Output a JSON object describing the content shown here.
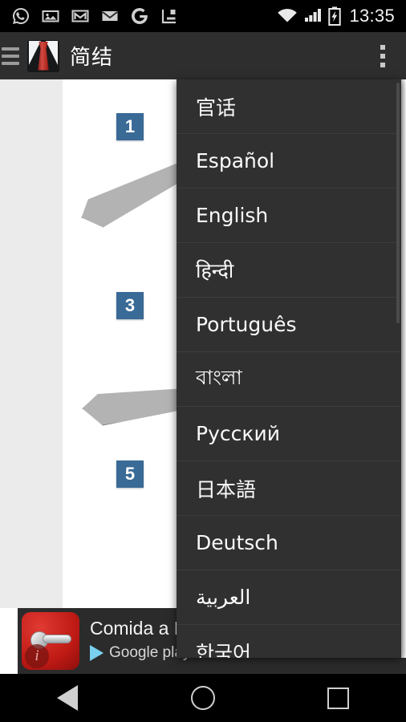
{
  "status_bar": {
    "time": "13:35",
    "left_icons": [
      {
        "name": "whatsapp-icon",
        "label": "WhatsApp"
      },
      {
        "name": "photos-icon",
        "label": "Photos"
      },
      {
        "name": "gmail-icon",
        "label": "Gmail"
      },
      {
        "name": "email-icon",
        "label": "Email"
      },
      {
        "name": "google-icon",
        "label": "Google"
      },
      {
        "name": "app-notification-icon",
        "label": "App"
      }
    ],
    "right_icons": [
      {
        "name": "wifi-icon",
        "label": "Wi-Fi"
      },
      {
        "name": "signal-icon",
        "label": "Signal"
      },
      {
        "name": "battery-charging-icon",
        "label": "Battery charging"
      }
    ]
  },
  "app_bar": {
    "menu_icon": "hamburger-icon",
    "app_icon": "necktie-icon",
    "title": "简结",
    "overflow_icon": "overflow-menu-icon",
    "background": "#2e2e2e"
  },
  "content": {
    "background": "#ebebeb",
    "card_background": "#ffffff",
    "steps": [
      {
        "number": "1"
      },
      {
        "number": "3"
      },
      {
        "number": "5"
      }
    ],
    "badge_color": "#3a6a96",
    "accent_color": "#e2552a",
    "tie_color": "#b3b3b3"
  },
  "ad": {
    "title": "Comida a Do",
    "store_label": "Google play",
    "icon_name": "door-handle-icon",
    "info_badge": "i",
    "cta_color": "#a4be2a"
  },
  "menu": {
    "background": "#303030",
    "items": [
      {
        "label": "官话",
        "rtl": false
      },
      {
        "label": "Español",
        "rtl": false
      },
      {
        "label": "English",
        "rtl": false
      },
      {
        "label": "हिन्दी",
        "rtl": false
      },
      {
        "label": "Português",
        "rtl": false
      },
      {
        "label": "বাংলা",
        "rtl": false
      },
      {
        "label": "Русский",
        "rtl": false
      },
      {
        "label": "日本語",
        "rtl": false
      },
      {
        "label": "Deutsch",
        "rtl": false
      },
      {
        "label": "العربية",
        "rtl": true
      },
      {
        "label": "한국어",
        "rtl": false
      }
    ]
  },
  "nav_bar": {
    "back": "back-icon",
    "home": "home-icon",
    "recents": "recents-icon"
  }
}
